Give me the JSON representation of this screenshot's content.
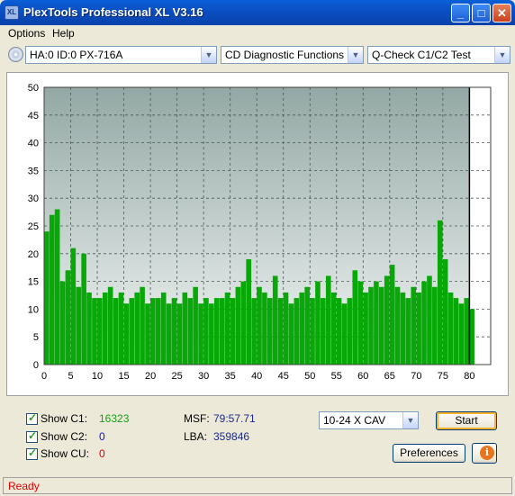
{
  "window": {
    "title": "PlexTools Professional XL V3.16",
    "icon_label": "XL",
    "controls": [
      "_",
      "□",
      "✕"
    ]
  },
  "menu": [
    "Options",
    "Help"
  ],
  "toolbar": {
    "drive": "HA:0 ID:0  PX-716A",
    "function": "CD Diagnostic Functions",
    "test": "Q-Check C1/C2 Test"
  },
  "chart_data": {
    "type": "bar",
    "x_ticks": [
      0,
      5,
      10,
      15,
      20,
      25,
      30,
      35,
      40,
      45,
      50,
      55,
      60,
      65,
      70,
      75,
      80
    ],
    "y_ticks": [
      0,
      5,
      10,
      15,
      20,
      25,
      30,
      35,
      40,
      45,
      50
    ],
    "xlim": [
      0,
      84
    ],
    "ylim": [
      0,
      50
    ],
    "grid": true,
    "disc_end_marker": 80,
    "series": [
      {
        "color": "#08a808",
        "x": [
          0,
          1,
          2,
          3,
          4,
          5,
          6,
          7,
          8,
          9,
          10,
          11,
          12,
          13,
          14,
          15,
          16,
          17,
          18,
          19,
          20,
          21,
          22,
          23,
          24,
          25,
          26,
          27,
          28,
          29,
          30,
          31,
          32,
          33,
          34,
          35,
          36,
          37,
          38,
          39,
          40,
          41,
          42,
          43,
          44,
          45,
          46,
          47,
          48,
          49,
          50,
          51,
          52,
          53,
          54,
          55,
          56,
          57,
          58,
          59,
          60,
          61,
          62,
          63,
          64,
          65,
          66,
          67,
          68,
          69,
          70,
          71,
          72,
          73,
          74,
          75,
          76,
          77,
          78,
          79,
          80
        ],
        "values": [
          24,
          27,
          28,
          15,
          17,
          21,
          14,
          20,
          13,
          12,
          12,
          13,
          14,
          12,
          13,
          11,
          12,
          13,
          14,
          11,
          12,
          12,
          13,
          11,
          12,
          11,
          13,
          12,
          14,
          11,
          12,
          11,
          12,
          12,
          13,
          12,
          14,
          15,
          19,
          12,
          14,
          13,
          12,
          16,
          12,
          13,
          11,
          12,
          13,
          14,
          12,
          15,
          12,
          16,
          13,
          12,
          11,
          12,
          17,
          15,
          13,
          14,
          15,
          14,
          16,
          18,
          14,
          13,
          12,
          14,
          13,
          15,
          16,
          14,
          26,
          19,
          13,
          12,
          11,
          12,
          10
        ]
      }
    ]
  },
  "stats": {
    "c1_label": "Show C1:",
    "c1_value": "16323",
    "c2_label": "Show C2:",
    "c2_value": "0",
    "cu_label": "Show CU:",
    "cu_value": "0",
    "msf_label": "MSF:",
    "msf_value": "79:57.71",
    "lba_label": "LBA:",
    "lba_value": "359846"
  },
  "speed_select": "10-24 X CAV",
  "buttons": {
    "start": "Start",
    "preferences": "Preferences",
    "info": "i"
  },
  "status": "Ready",
  "colors": {
    "c1": "#16a016",
    "c2": "#1111cc",
    "cu": "#e00000",
    "lba": "#1a2a8a",
    "bars": "#08a808"
  }
}
